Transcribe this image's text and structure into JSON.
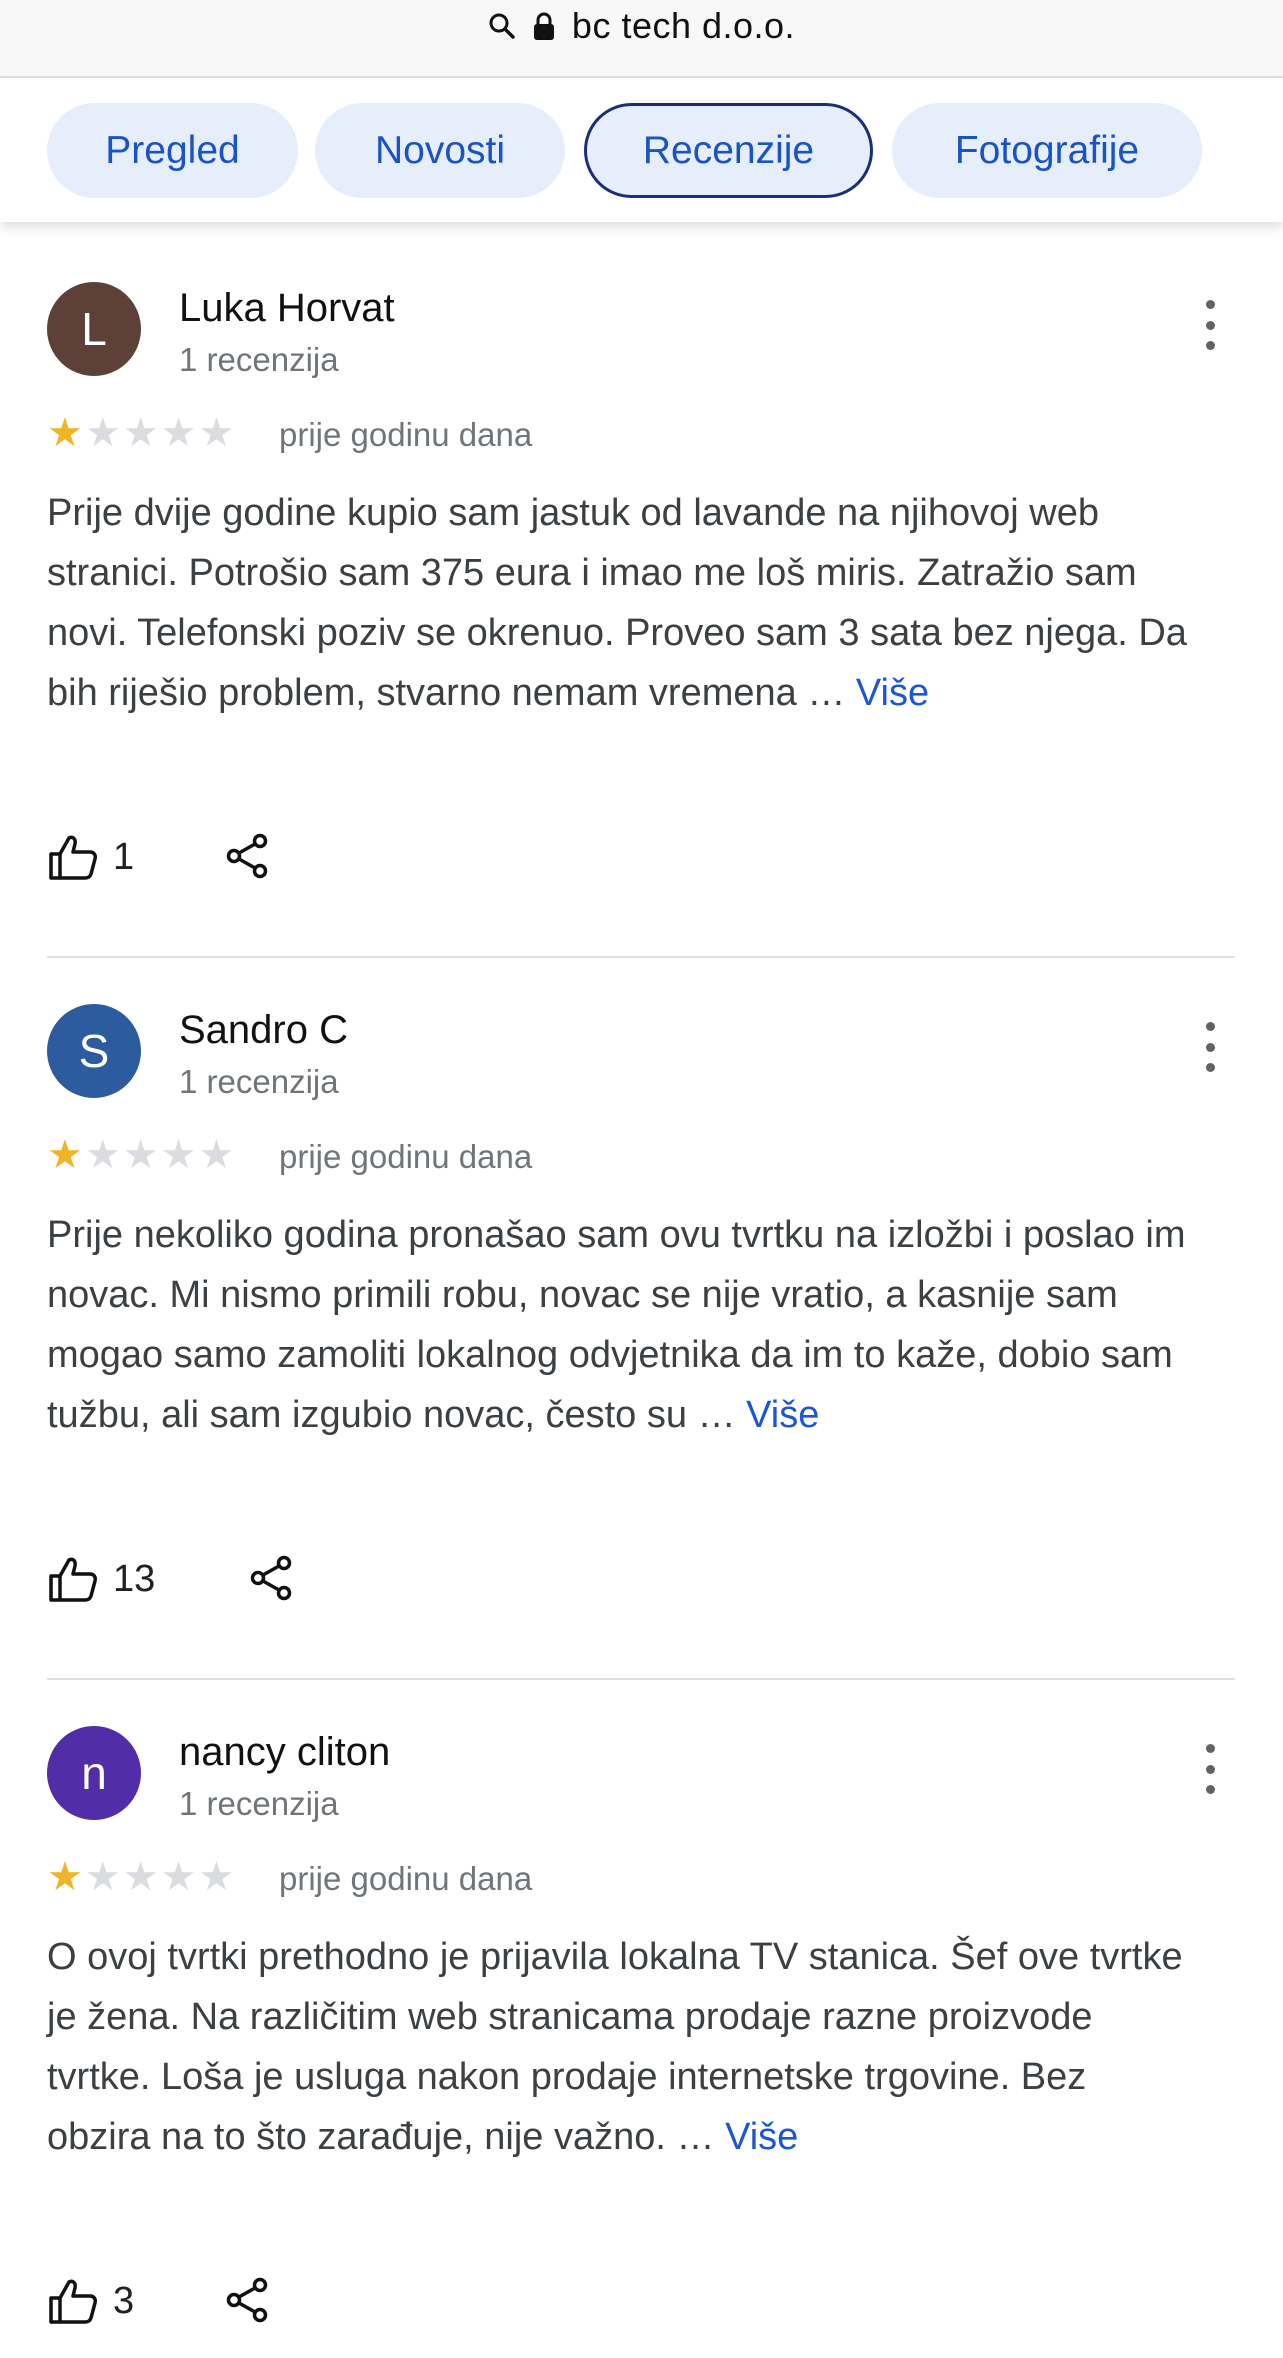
{
  "browser": {
    "url": "bc tech d.o.o."
  },
  "tabs": [
    {
      "label": "Pregled"
    },
    {
      "label": "Novosti"
    },
    {
      "label": "Recenzije",
      "active": true
    },
    {
      "label": "Fotografije"
    }
  ],
  "more_link": "Više",
  "reviews": [
    {
      "initial": "L",
      "avatar_color": "#5d4037",
      "name": "Luka Horvat",
      "review_count": "1 recenzija",
      "rating": 1,
      "date": "prije godinu dana",
      "text": "Prije dvije godine kupio sam jastuk od lavande na njihovoj web stranici. Potrošio sam 375 eura i imao me loš miris. Zatražio sam novi. Telefonski poziv se okrenuo. Proveo sam 3 sata bez njega. Da bih riješio problem, stvarno nemam vremena …",
      "likes": "1"
    },
    {
      "initial": "S",
      "avatar_color": "#2c5b9e",
      "name": "Sandro C",
      "review_count": "1 recenzija",
      "rating": 1,
      "date": "prije godinu dana",
      "text": "Prije nekoliko godina pronašao sam ovu tvrtku na izložbi i poslao im novac. Mi nismo primili robu, novac se nije vratio, a kasnije sam mogao samo zamoliti lokalnog odvjetnika da im to kaže, dobio sam tužbu, ali sam izgubio novac, često su …",
      "likes": "13"
    },
    {
      "initial": "n",
      "avatar_color": "#512da8",
      "name": "nancy cliton",
      "review_count": "1 recenzija",
      "rating": 1,
      "date": "prije godinu dana",
      "text": "O ovoj tvrtki prethodno je prijavila lokalna TV stanica. Šef ove tvrtke je žena. Na različitim web stranicama prodaje razne proizvode tvrtke. Loša je usluga nakon prodaje internetske trgovine. Bez obzira na to što zarađuje, nije važno. …",
      "likes": "3"
    }
  ]
}
